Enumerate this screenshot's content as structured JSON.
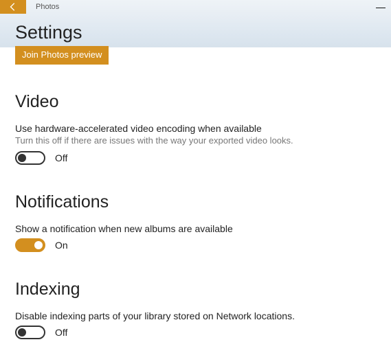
{
  "titlebar": {
    "app_name": "Photos",
    "minimize": "—"
  },
  "header": {
    "page_title": "Settings",
    "join_button": "Join Photos preview"
  },
  "sections": {
    "video": {
      "heading": "Video",
      "setting_title": "Use hardware-accelerated video encoding when available",
      "setting_desc": "Turn this off if there are issues with the way your exported video looks.",
      "toggle_state": "Off"
    },
    "notifications": {
      "heading": "Notifications",
      "setting_title": "Show a notification when new albums are available",
      "toggle_state": "On"
    },
    "indexing": {
      "heading": "Indexing",
      "setting_title": "Disable indexing parts of your library stored on Network locations.",
      "toggle_state": "Off"
    }
  }
}
